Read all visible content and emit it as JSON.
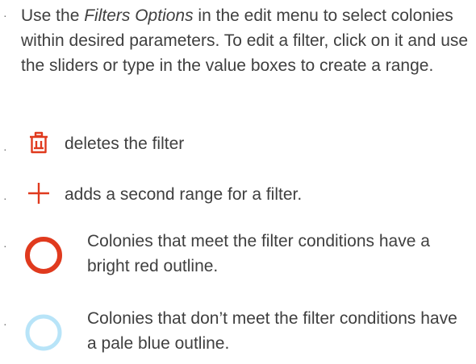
{
  "bullet_symbol": "·",
  "intro": {
    "lead": "Use the ",
    "emphasis": "Filters Options",
    "rest": " in the edit menu to select colonies within desired parameters. To edit a filter, click on it and use the sliders or type in the value boxes to create a range."
  },
  "items": [
    {
      "icon": "trash-icon",
      "text": "deletes the filter"
    },
    {
      "icon": "plus-icon",
      "text": "adds a second range for a filter."
    },
    {
      "icon": "red-circle-icon",
      "text": "Colonies that meet the filter conditions have a bright red outline."
    },
    {
      "icon": "blue-circle-icon",
      "text": "Colonies that don’t meet the filter conditions have a pale blue outline."
    }
  ],
  "colors": {
    "accent_red": "#e03a1e",
    "pale_blue": "#b8e4f8",
    "text": "#3f3f3f"
  }
}
